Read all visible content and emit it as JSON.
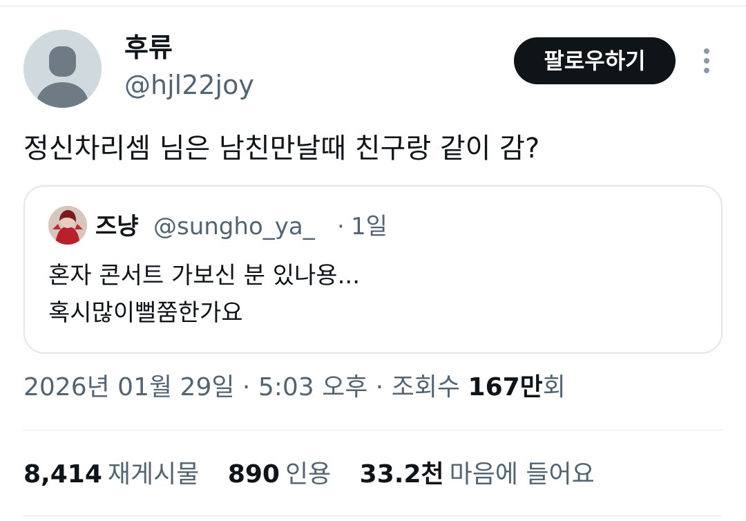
{
  "author": {
    "display_name": "후류",
    "handle": "@hjl22joy",
    "follow_label": "팔로우하기"
  },
  "tweet": {
    "text": "정신차리셈 님은 남친만날때 친구랑 같이 감?"
  },
  "quote": {
    "display_name": "즈냥",
    "handle": "@sungho_ya_",
    "dot": "·",
    "time": "1일",
    "lines": [
      "혼자 콘서트 가보신 분 있나용...",
      "혹시많이뻘쭘한가요"
    ]
  },
  "meta": {
    "date": "2026년 01월 29일",
    "sep1": " · ",
    "time": "5:03 오후",
    "sep2": " · ",
    "views_label": "조회수 ",
    "views_num": "167만",
    "views_suffix": "회"
  },
  "stats": [
    {
      "value": "8,414",
      "label": "재게시물"
    },
    {
      "value": "890",
      "label": "인용"
    },
    {
      "value": "33.2천",
      "label": "마음에 들어요"
    }
  ],
  "colors": {
    "text_primary": "#0f1419",
    "text_secondary": "#536471",
    "button_bg": "#0f1419",
    "border": "#e1e6ea",
    "avatar_bg": "#cfd9de"
  },
  "icons": {
    "avatar": "default-profile-icon",
    "more": "more-vertical-icon"
  }
}
